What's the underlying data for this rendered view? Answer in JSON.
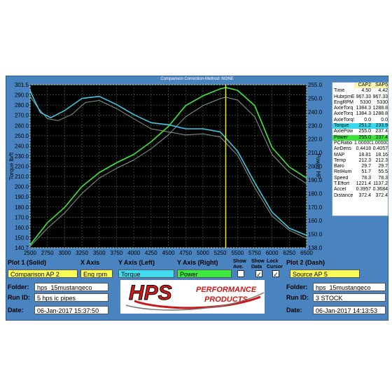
{
  "chart_header": "Comparison  Correction-Method: NONE",
  "chart_data": {
    "type": "line",
    "x_ticks": [
      "2500",
      "2750",
      "3000",
      "3250",
      "3500",
      "3750",
      "4000",
      "4250",
      "4500",
      "4750",
      "5000",
      "5250",
      "5500",
      "5750",
      "6000",
      "6250",
      "6500"
    ],
    "xlim": [
      2500,
      6500
    ],
    "y_left_ticks": [
      "301.5",
      "290.0",
      "280.0",
      "270.0",
      "260.0",
      "250.0",
      "240.0",
      "230.0",
      "220.0",
      "210.0",
      "200.0",
      "190.0",
      "180.0",
      "170.0",
      "160.0",
      "150.0",
      "140.7"
    ],
    "y_right_ticks": [
      "255.0",
      "250.0",
      "240.0",
      "230.0",
      "220.0",
      "210.0",
      "200.0",
      "190.0",
      "180.0",
      "170.0",
      "160.0",
      "150.0",
      "138.0"
    ],
    "y_left_label": "Torque lb/ft",
    "y_right_label": "Power HP",
    "ylim_left": [
      140.7,
      301.5
    ],
    "ylim_right": [
      138.0,
      255.0
    ],
    "cursor_x": 5330,
    "series": [
      {
        "axis": "left",
        "color": "#3fc8e8",
        "x": [
          2500,
          2550,
          2650,
          2800,
          3000,
          3250,
          3500,
          3750,
          4000,
          4250,
          4500,
          4750,
          5000,
          5250,
          5500,
          5750,
          6000,
          6250,
          6500
        ],
        "y": [
          296,
          288,
          274,
          269,
          276,
          288,
          290,
          282,
          272,
          264,
          262,
          258,
          258,
          255,
          236,
          205,
          176,
          160,
          153
        ]
      },
      {
        "axis": "left",
        "color": "#8a9a8a",
        "x": [
          2500,
          2600,
          2750,
          2900,
          3100,
          3300,
          3500,
          3750,
          4000,
          4250,
          4500,
          4750,
          5000,
          5250,
          5500,
          5750,
          6000,
          6250,
          6500
        ],
        "y": [
          290,
          280,
          268,
          266,
          272,
          284,
          286,
          278,
          268,
          258,
          255,
          252,
          253,
          250,
          232,
          200,
          172,
          158,
          150
        ]
      },
      {
        "axis": "right",
        "color": "#3ee83e",
        "x": [
          2500,
          2750,
          3000,
          3250,
          3500,
          3750,
          4000,
          4250,
          4500,
          4750,
          5000,
          5250,
          5330,
          5500,
          5750,
          6000,
          6250,
          6500
        ],
        "y": [
          140,
          156,
          167,
          182,
          192,
          199,
          205,
          214,
          225,
          240,
          247,
          252,
          253,
          251,
          240,
          210,
          196,
          188
        ]
      },
      {
        "axis": "right",
        "color": "#8a9a8a",
        "x": [
          2500,
          2750,
          3000,
          3250,
          3500,
          3750,
          4000,
          4250,
          4500,
          4750,
          5000,
          5250,
          5330,
          5500,
          5750,
          6000,
          6250,
          6500
        ],
        "y": [
          139,
          152,
          163,
          177,
          188,
          195,
          201,
          209,
          219,
          232,
          240,
          245,
          246,
          244,
          232,
          205,
          192,
          184
        ]
      }
    ]
  },
  "panel": {
    "col1": "CAP2",
    "col2": "SAP5",
    "rows": [
      {
        "label": "Time",
        "v1": "4.50",
        "v2": "4.42",
        "hl": ""
      },
      {
        "label": "HubrpmEngRPM",
        "v1": "967.33",
        "v2": "967.33",
        "hl": ""
      },
      {
        "label": "EngRPM",
        "v1": "5330",
        "v2": "5330",
        "hl": ""
      },
      {
        "label": "AxleTorq",
        "v1": "1384.3",
        "v2": "1288.8",
        "hl": ""
      },
      {
        "label": "AxleTorq",
        "v1": "1384.3",
        "v2": "1288.8",
        "hl": ""
      },
      {
        "label": "AxleTorqS",
        "v1": "0.0",
        "v2": "0.0",
        "hl": ""
      },
      {
        "label": "Torque",
        "v1": "251.2",
        "v2": "233.9",
        "hl": "cyan"
      },
      {
        "label": "AxlePow",
        "v1": "255.0",
        "v2": "237.4",
        "hl": ""
      },
      {
        "label": "Power",
        "v1": "255.0",
        "v2": "237.4",
        "hl": "green"
      },
      {
        "label": "PCRatio",
        "v1": "1.00000",
        "v2": "1.00000",
        "hl": ""
      },
      {
        "label": "AirDens",
        "v1": "0.4418",
        "v2": "0.4057",
        "hl": ""
      },
      {
        "label": "MAP",
        "v1": "18.81",
        "v2": "18.16",
        "hl": ""
      },
      {
        "label": "Temp",
        "v1": "212.3",
        "v2": "212.3",
        "hl": ""
      },
      {
        "label": "Baro",
        "v1": "29.7",
        "v2": "29.7",
        "hl": ""
      },
      {
        "label": "RelHum",
        "v1": "51.7",
        "v2": "55.5",
        "hl": ""
      },
      {
        "label": "Speed",
        "v1": "78.3",
        "v2": "78.3",
        "hl": ""
      },
      {
        "label": "T.Effort",
        "v1": "1221.4",
        "v2": "1137.2",
        "hl": ""
      },
      {
        "label": "Accel",
        "v1": "0.3957",
        "v2": "0.3684",
        "hl": ""
      },
      {
        "label": "Distance",
        "v1": "372.4",
        "v2": "372.4",
        "hl": ""
      }
    ]
  },
  "controls": {
    "plot1_label": "Plot 1 (Solid)",
    "plot1_value": "Comparison AP 2",
    "xaxis_label": "X Axis",
    "xaxis_value": "Eng rpm",
    "yleft_label": "Y Axis (Left)",
    "yleft_value": "Torque",
    "yright_label": "Y Axis (Right)",
    "yright_value": "Power",
    "show_ave_label": "Show Ave.",
    "show_data_label": "Show Data",
    "lock_cursor_label": "Lock Cursor",
    "plot2_label": "Plot 2 (Dash)",
    "plot2_value": "Source AP 5",
    "folder_label": "Folder:",
    "runid_label": "Run ID:",
    "date_label": "Date:",
    "left_folder": "hps_15mustangeco",
    "left_runid": "5 hps ic pipes",
    "left_date": "06-Jan-2017  15:37:50",
    "right_folder": "hps_15mustangeco",
    "right_runid": "3 STOCK",
    "right_date": "06-Jan-2017  14:13:53",
    "logo_main": "HPS",
    "logo_sub1": "PERFORMANCE",
    "logo_sub2": "PRODUCTS",
    "check_mark": "✓"
  }
}
